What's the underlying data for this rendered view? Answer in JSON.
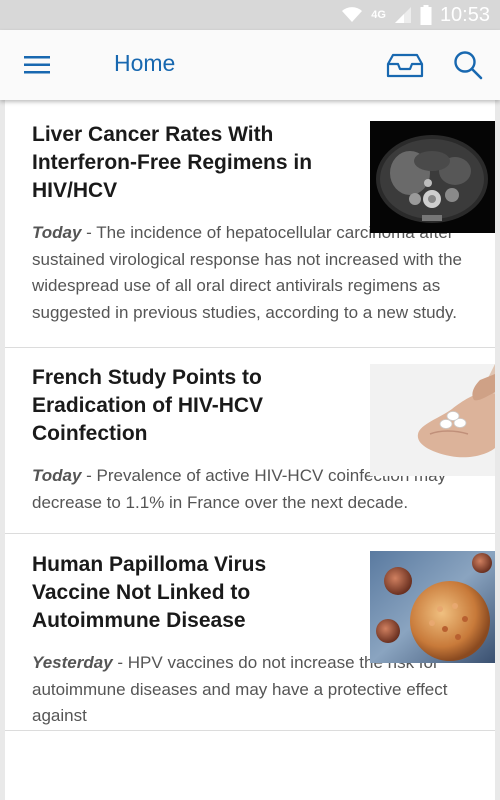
{
  "status_bar": {
    "network": "4G",
    "time": "10:53"
  },
  "app_bar": {
    "title": "Home",
    "menu_icon": "hamburger-menu-icon",
    "inbox_icon": "inbox-tray-icon",
    "search_icon": "search-icon"
  },
  "colors": {
    "accent": "#1868b0",
    "headline": "#1a1a1a",
    "body_text": "#555555",
    "status_bar": "#d8d8d8"
  },
  "articles": [
    {
      "title": "Liver Cancer Rates With Interferon-Free Regimens in HIV/HCV",
      "date": "Today",
      "summary": " - The incidence of hepatocellular carcinoma after sustained virological response has not increased with the widespread use of all oral direct antivirals regimens as suggested in previous studies, according to a new study.",
      "image": "ct-scan-image"
    },
    {
      "title": "French Study Points to Eradication of HIV-HCV Coinfection",
      "date": "Today",
      "summary": " - Prevalence of active HIV-HCV coinfection may decrease to 1.1% in France over the next decade.",
      "image": "pills-in-hand-image"
    },
    {
      "title": "Human Papilloma Virus Vaccine Not Linked to Autoimmune Disease",
      "date": "Yesterday",
      "summary": " - HPV vaccines do not increase the risk for autoimmune diseases and may have a protective effect against",
      "image": "virus-particles-image"
    }
  ]
}
